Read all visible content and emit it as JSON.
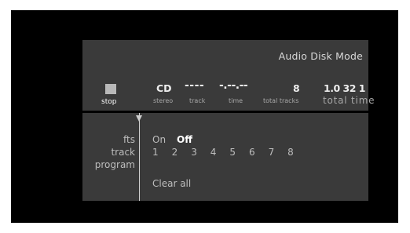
{
  "status": {
    "mode_title": "Audio Disk Mode",
    "stop_label": "stop",
    "disc_type": "CD",
    "audio_channel": "stereo",
    "track_value": "----",
    "track_caption": "track",
    "time_value": "-.--.--",
    "time_caption": "time",
    "total_tracks_value": "8",
    "total_tracks_caption": "total tracks",
    "total_time_value": "1.0 32 1",
    "total_time_caption": "total time"
  },
  "program": {
    "fts_label": "fts",
    "track_label": "track",
    "program_label": "program",
    "fts_on": "On",
    "fts_off": "Off",
    "fts_selected": "Off",
    "tracks": [
      "1",
      "2",
      "3",
      "4",
      "5",
      "6",
      "7",
      "8"
    ],
    "clear_all": "Clear all"
  },
  "colors": {
    "screen_bg": "#000000",
    "panel_bg": "#3a3a3a",
    "text": "#bdbdbd",
    "highlight": "#ffffff"
  },
  "icons": {
    "stop": "stop-square-icon",
    "pointer": "down-triangle-icon"
  }
}
